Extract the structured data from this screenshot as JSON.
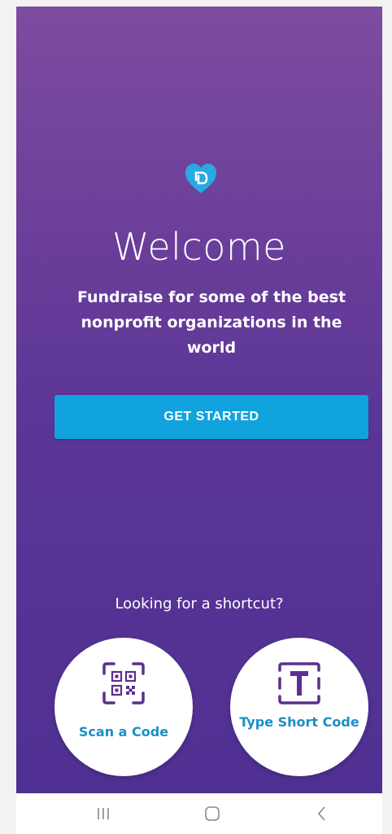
{
  "welcome": {
    "title": "Welcome",
    "tagline": "Fundraise for some of the best nonprofit organizations in the world",
    "cta_label": "GET STARTED",
    "logo_icon": "heart-logo-icon"
  },
  "shortcuts": {
    "prompt": "Looking for a shortcut?",
    "scan": {
      "label": "Scan a Code",
      "icon": "qr-code-icon"
    },
    "type": {
      "label": "Type Short Code",
      "icon": "text-box-icon"
    }
  },
  "navbar": {
    "recent_icon": "recent-apps-icon",
    "home_icon": "home-icon",
    "back_icon": "back-icon"
  },
  "colors": {
    "gradient_top": "#7e4c9f",
    "gradient_bottom": "#4f3092",
    "accent_blue": "#11a3de",
    "label_blue": "#1a8fc6"
  }
}
